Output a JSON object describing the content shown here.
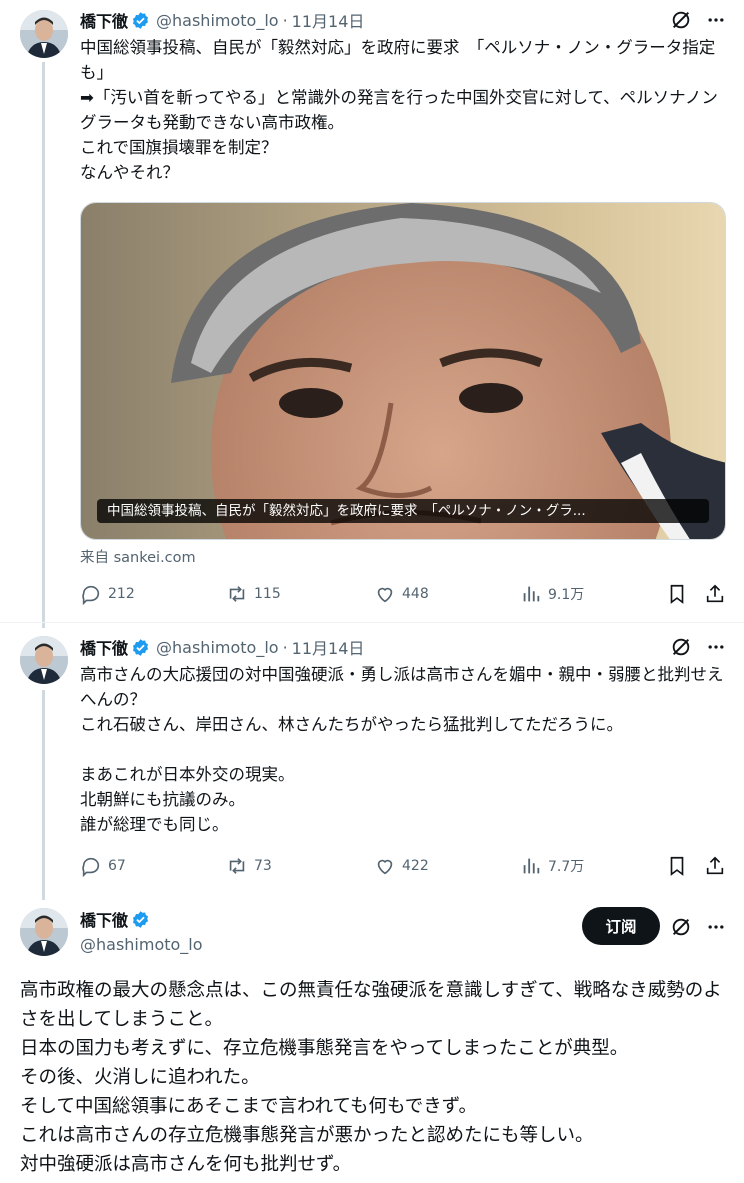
{
  "author": {
    "name": "橋下徹",
    "handle": "@hashimoto_lo",
    "dot": "·"
  },
  "tweet1": {
    "date": "11月14日",
    "text": "中国総領事投稿、自民が「毅然対応」を政府に要求　「ペルソナ・ノン・グラータ指定も」\n➡「汚い首を斬ってやる」と常識外の発言を行った中国外交官に対して、ペルソナノングラータも発動できない高市政権。\nこれで国旗損壊罪を制定？\nなんやそれ？",
    "card_caption": "中国総領事投稿、自民が「毅然対応」を政府に要求　「ペルソナ・ノン・グラ...",
    "card_source": "来自 sankei.com",
    "replies": "212",
    "reposts": "115",
    "likes": "448",
    "views": "9.1万"
  },
  "tweet2": {
    "date": "11月14日",
    "text": "高市さんの大応援団の対中国強硬派・勇し派は高市さんを媚中・親中・弱腰と批判せえへんの？\nこれ石破さん、岸田さん、林さんたちがやったら猛批判してただろうに。\n\nまあこれが日本外交の現実。\n北朝鮮にも抗議のみ。\n誰が総理でも同じ。",
    "replies": "67",
    "reposts": "73",
    "likes": "422",
    "views": "7.7万"
  },
  "tweet3": {
    "follow_label": "订阅",
    "text": "高市政権の最大の懸念点は、この無責任な強硬派を意識しすぎて、戦略なき威勢のよさを出してしまうこと。\n日本の国力も考えずに、存立危機事態発言をやってしまったことが典型。\nその後、火消しに追われた。\nそして中国総領事にあそこまで言われても何もできず。\nこれは高市さんの存立危機事態発言が悪かったと認めたにも等しい。\n対中強硬派は高市さんを何も批判せず。"
  },
  "icons": {
    "verified": "verified-badge-icon",
    "grok": "grok-icon",
    "more": "more-icon",
    "reply": "reply-icon",
    "repost": "repost-icon",
    "like": "like-icon",
    "views": "views-icon",
    "bookmark": "bookmark-icon",
    "share": "share-icon"
  },
  "colors": {
    "verified": "#1d9bf0",
    "text": "#0f1419",
    "secondary": "#536471",
    "thread_line": "#cfd9de"
  }
}
